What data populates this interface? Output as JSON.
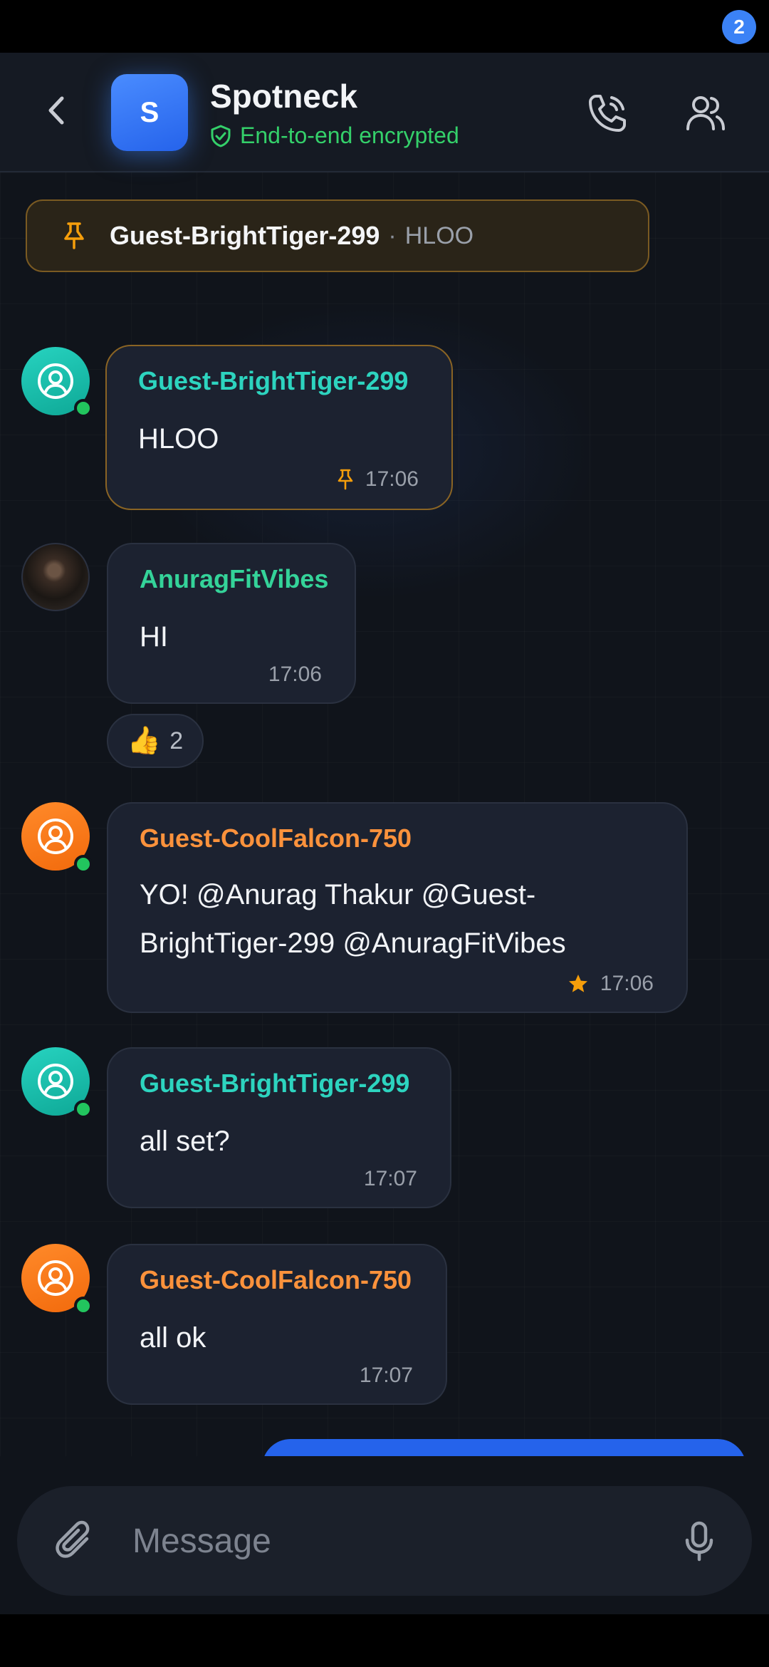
{
  "header": {
    "avatar_letter": "S",
    "title": "Spotneck",
    "encryption": "End-to-end encrypted",
    "members_badge": "2"
  },
  "pinned": {
    "author": "Guest-BrightTiger-299",
    "separator": "·",
    "text": "HLOO"
  },
  "messages": [
    {
      "sender": "Guest-BrightTiger-299",
      "text": "HLOO",
      "time": "17:06",
      "pinned": true,
      "avatar": "user-icon",
      "color": "#2dd4bf",
      "online": true
    },
    {
      "sender": "AnuragFitVibes",
      "text": "HI",
      "time": "17:06",
      "avatar": "photo",
      "color": "#34d399",
      "online": false,
      "reaction": {
        "emoji": "👍",
        "count": "2"
      }
    },
    {
      "sender": "Guest-CoolFalcon-750",
      "text": "YO! @Anurag Thakur @Guest-\nBrightTiger-299 @AnuragFitVibes",
      "time": "17:06",
      "starred": true,
      "avatar": "user-icon",
      "color": "#fb923c",
      "online": true
    },
    {
      "sender": "Guest-BrightTiger-299",
      "text": "all set?",
      "time": "17:07",
      "avatar": "user-icon",
      "color": "#2dd4bf",
      "online": true
    },
    {
      "sender": "Guest-CoolFalcon-750",
      "text": "all ok",
      "time": "17:07",
      "avatar": "user-icon",
      "color": "#fb923c",
      "online": true
    }
  ],
  "composer": {
    "placeholder": "Message"
  },
  "colors": {
    "accent": "#3b82f6",
    "online": "#22c55e",
    "pin": "#f59e0b"
  }
}
